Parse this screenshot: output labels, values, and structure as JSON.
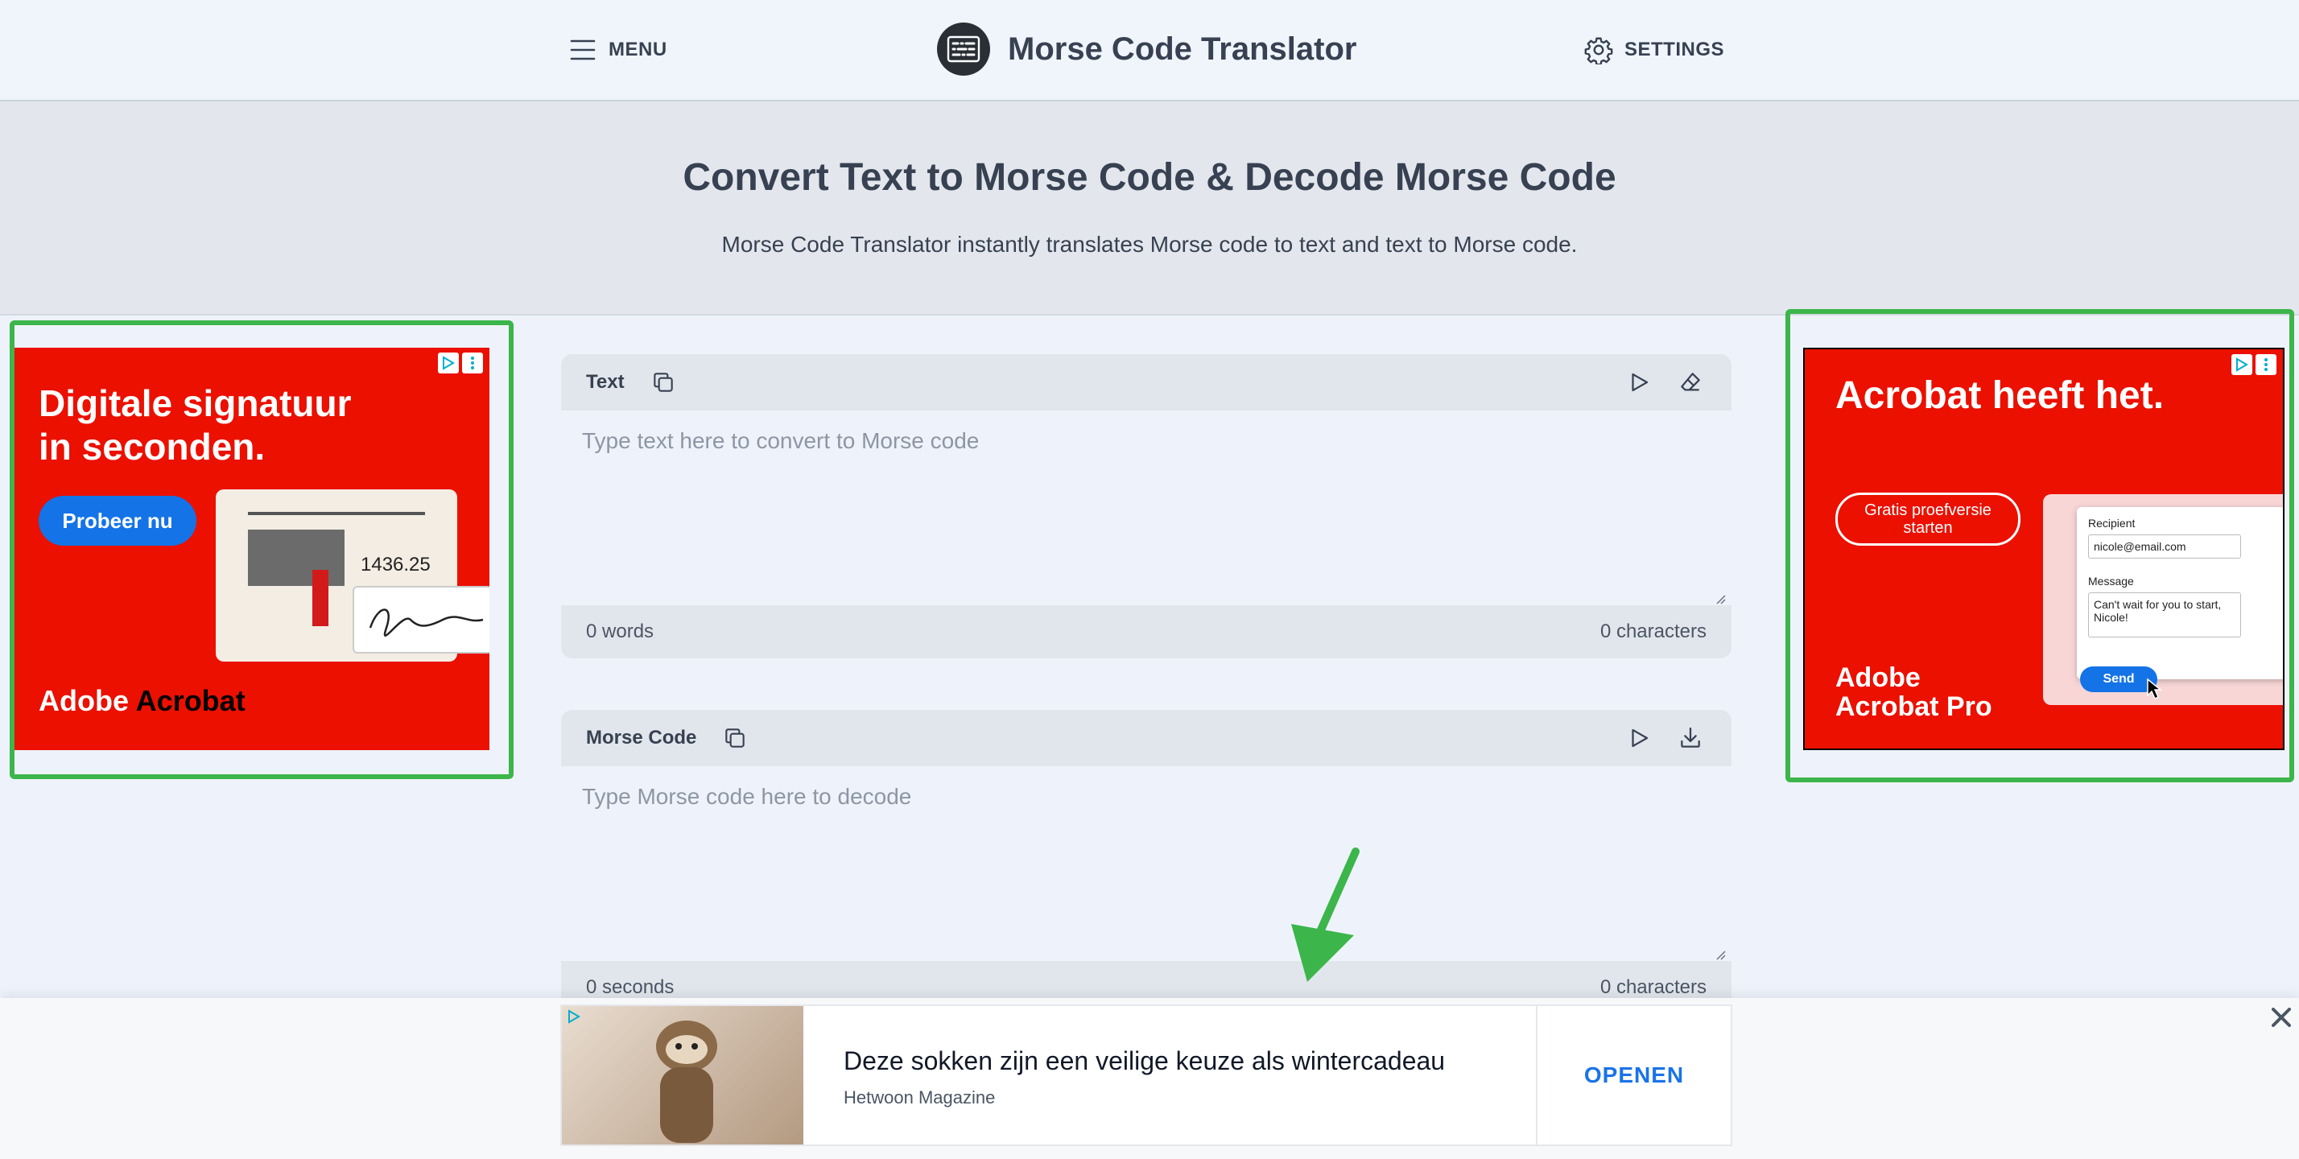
{
  "header": {
    "menu_label": "MENU",
    "brand_name": "Morse Code Translator",
    "settings_label": "SETTINGS"
  },
  "hero": {
    "title": "Convert Text to Morse Code & Decode Morse Code",
    "subtitle": "Morse Code Translator instantly translates Morse code to text and text to Morse code."
  },
  "text_panel": {
    "title": "Text",
    "placeholder": "Type text here to convert to Morse code",
    "value": "",
    "words": "0 words",
    "characters": "0 characters"
  },
  "morse_panel": {
    "title": "Morse Code",
    "placeholder": "Type Morse code here to decode",
    "value": "",
    "seconds": "0 seconds",
    "characters": "0 characters"
  },
  "ad_left": {
    "headline_1": "Digitale signatuur",
    "headline_2": "in seconden.",
    "cta": "Probeer nu",
    "doc_value": "1436.25",
    "brand_a": "Adobe",
    "brand_b": " Acrobat"
  },
  "ad_right": {
    "headline": "Acrobat heeft het.",
    "cta_1": "Gratis proefversie",
    "cta_2": "starten",
    "recipient_label": "Recipient",
    "recipient_value": "nicole@email.com",
    "message_label": "Message",
    "message_value": "Can't wait for you to start, Nicole!",
    "send_label": "Send",
    "brand_1": "Adobe",
    "brand_2": "Acrobat Pro"
  },
  "bottom_ad": {
    "headline": "Deze sokken zijn een veilige keuze als wintercadeau",
    "source": "Hetwoon Magazine",
    "cta": "OPENEN"
  },
  "colors": {
    "accent_green": "#3cb54a",
    "adobe_red": "#eb1000",
    "link_blue": "#1a73e8"
  }
}
